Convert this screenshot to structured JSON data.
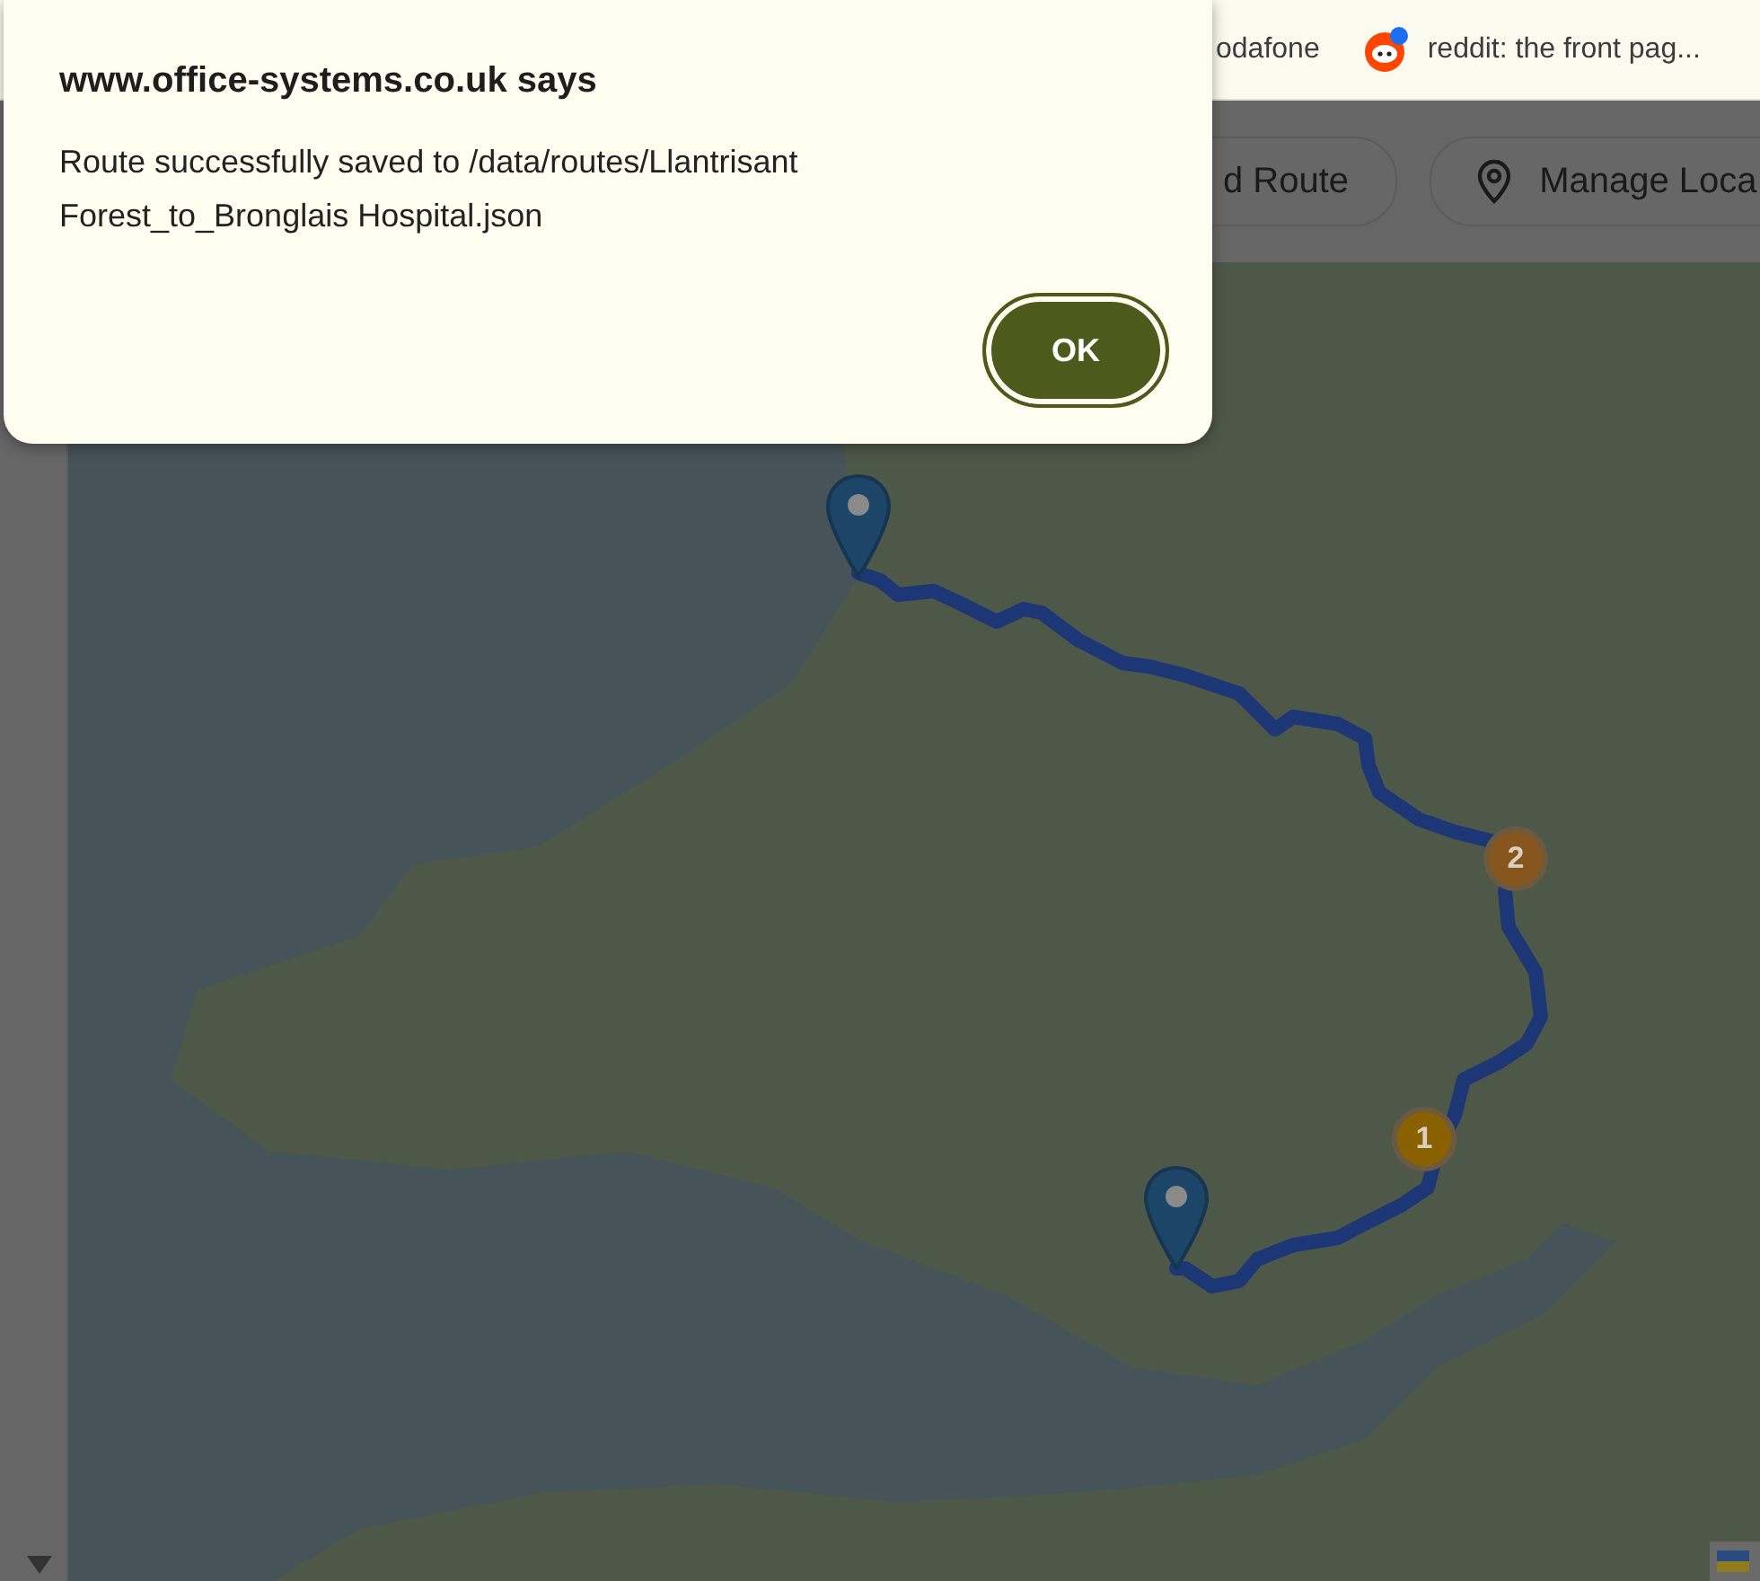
{
  "bookmarks": [
    {
      "label": "odafone",
      "kind": "plain"
    },
    {
      "label": "reddit: the front pag...",
      "kind": "reddit"
    }
  ],
  "toolbar": {
    "buttons": [
      {
        "label": "d Route",
        "kind": "plain"
      },
      {
        "label": "Manage Loca",
        "kind": "pin"
      }
    ]
  },
  "map": {
    "clusters": [
      {
        "label": "2",
        "color": "#87561f"
      },
      {
        "label": "1",
        "color": "#8a6100"
      }
    ]
  },
  "dialog": {
    "title": "www.office-systems.co.uk says",
    "message": "Route successfully saved to /data/routes/Llantrisant Forest_to_Bronglais Hospital.json",
    "button": "OK"
  }
}
